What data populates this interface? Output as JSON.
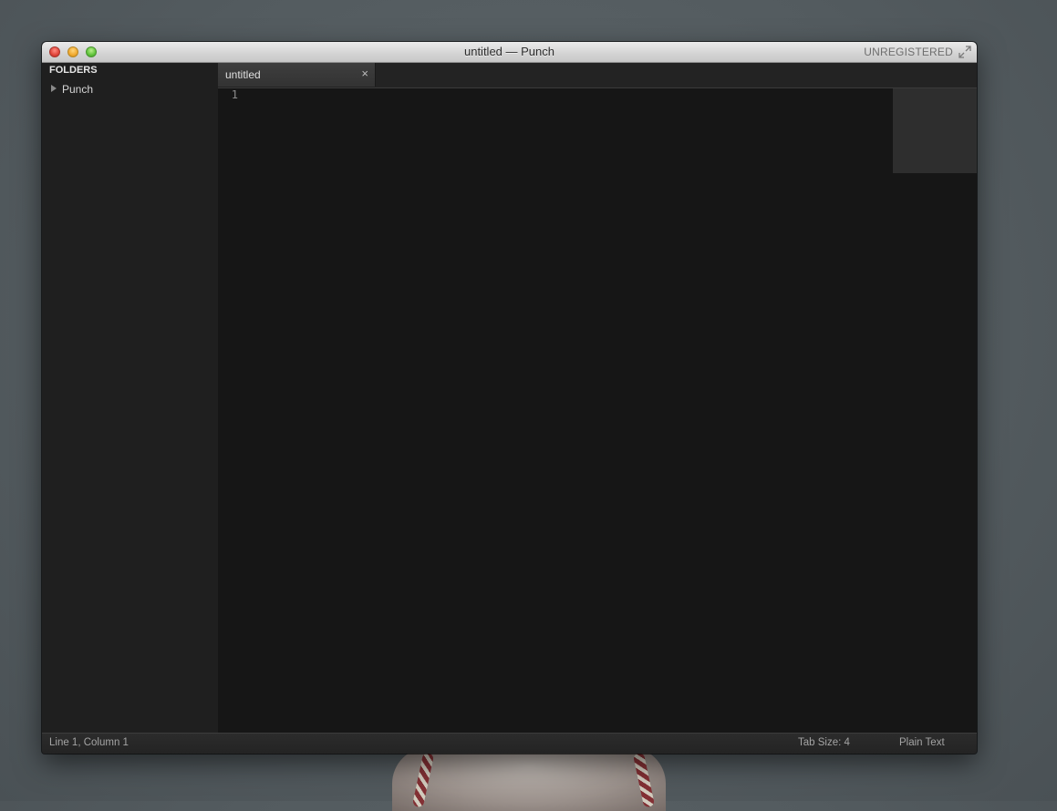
{
  "window": {
    "title": "untitled — Punch",
    "registration": "UNREGISTERED",
    "buttons": [
      "close-icon",
      "minimize-icon",
      "zoom-icon"
    ],
    "fullscreen_icon": "fullscreen-arrows-icon"
  },
  "sidebar": {
    "heading": "FOLDERS",
    "folders": [
      {
        "label": "Punch",
        "icon": "disclosure-triangle-icon"
      }
    ]
  },
  "tabs": [
    {
      "label": "untitled",
      "close": "×",
      "active": true
    }
  ],
  "editor": {
    "line_numbers": [
      "1"
    ]
  },
  "statusbar": {
    "position": "Line 1, Column 1",
    "tab_size": "Tab Size: 4",
    "syntax": "Plain Text"
  },
  "colors": {
    "editor_bg": "#161616",
    "sidebar_bg": "#1f1f1f",
    "close": "#e0443a",
    "minimize": "#f0a92f",
    "zoom": "#5fc33a"
  }
}
